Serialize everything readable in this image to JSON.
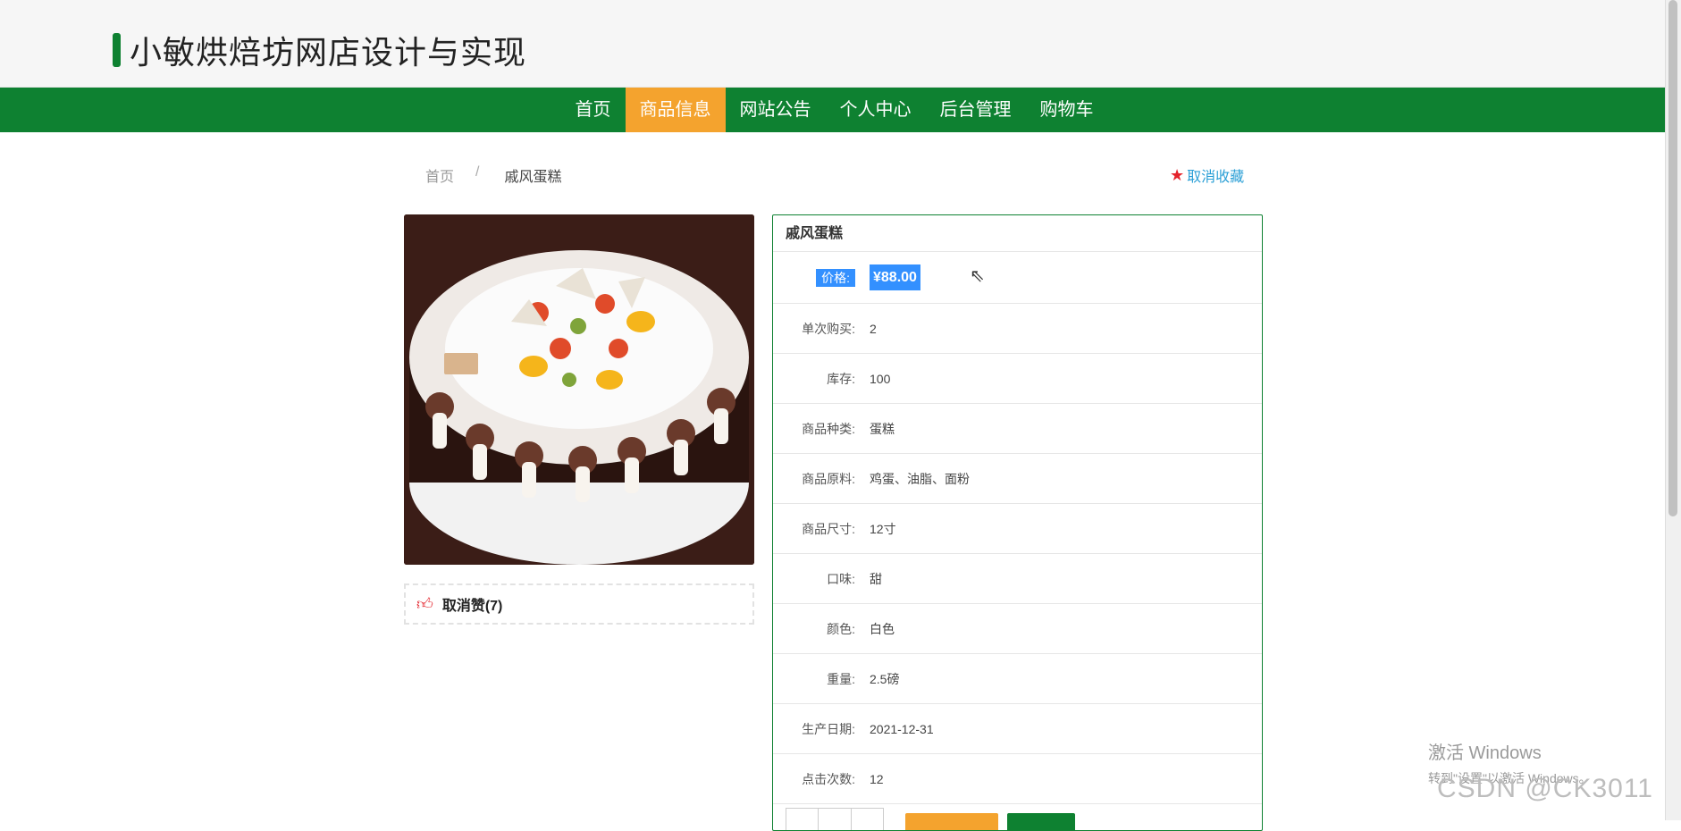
{
  "brand": {
    "title": "小敏烘焙坊网店设计与实现"
  },
  "nav": {
    "items": [
      "首页",
      "商品信息",
      "网站公告",
      "个人中心",
      "后台管理",
      "购物车"
    ],
    "active_index": 1
  },
  "breadcrumb": {
    "home": "首页",
    "separator": "/",
    "current": "戚风蛋糕"
  },
  "favorite": {
    "label": "取消收藏"
  },
  "like": {
    "label": "取消赞(7)"
  },
  "product": {
    "title": "戚风蛋糕",
    "price_label": "价格:",
    "price_value": "¥88.00",
    "rows": [
      {
        "label": "单次购买:",
        "value": "2"
      },
      {
        "label": "库存:",
        "value": "100"
      },
      {
        "label": "商品种类:",
        "value": "蛋糕"
      },
      {
        "label": "商品原料:",
        "value": "鸡蛋、油脂、面粉"
      },
      {
        "label": "商品尺寸:",
        "value": "12寸"
      },
      {
        "label": "口味:",
        "value": "甜"
      },
      {
        "label": "颜色:",
        "value": "白色"
      },
      {
        "label": "重量:",
        "value": "2.5磅"
      },
      {
        "label": "生产日期:",
        "value": "2021-12-31"
      },
      {
        "label": "点击次数:",
        "value": "12"
      }
    ]
  },
  "overlay": {
    "activate_line1": "激活 Windows",
    "activate_line2": "转到\"设置\"以激活 Windows。",
    "csdn": "CSDN @CK3011"
  },
  "colors": {
    "brand_green": "#0e8131",
    "active_orange": "#f4a32e",
    "link_blue": "#2b9fd6",
    "highlight_blue": "#3390ff"
  }
}
